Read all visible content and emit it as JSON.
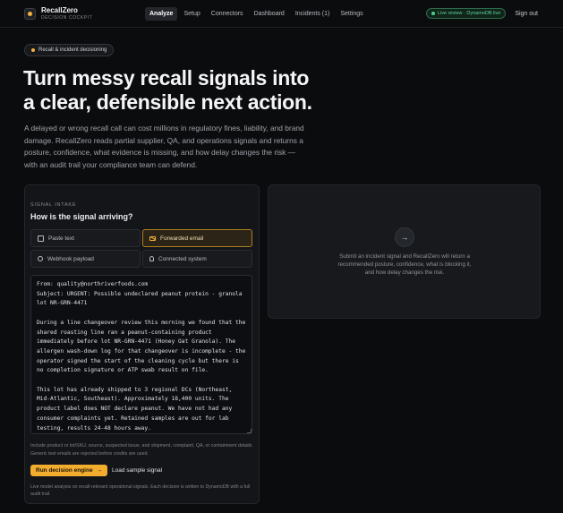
{
  "brand": {
    "name": "RecallZero",
    "subtitle": "DECISION COCKPIT"
  },
  "nav": {
    "links": [
      {
        "label": "Analyze",
        "active": true
      },
      {
        "label": "Setup",
        "active": false
      },
      {
        "label": "Connectors",
        "active": false
      },
      {
        "label": "Dashboard",
        "active": false
      },
      {
        "label": "Incidents (1)",
        "active": false
      },
      {
        "label": "Settings",
        "active": false
      }
    ],
    "live_status": "Live review · DynamoDB live",
    "sign_out": "Sign out"
  },
  "hero": {
    "badge": "Recall & incident decisioning",
    "title": "Turn messy recall signals into a clear, defensible next action.",
    "body": "A delayed or wrong recall call can cost millions in regulatory fines, liability, and brand damage. RecallZero reads partial supplier, QA, and operations signals and returns a posture, confidence, what evidence is missing, and how delay changes the risk — with an audit trail your compliance team can defend."
  },
  "intake": {
    "eyebrow": "SIGNAL INTAKE",
    "title": "How is the signal arriving?",
    "options": [
      {
        "label": "Paste text",
        "icon": "document-icon",
        "selected": false
      },
      {
        "label": "Forwarded email",
        "icon": "mail-icon",
        "selected": true
      },
      {
        "label": "Webhook payload",
        "icon": "webhook-icon",
        "selected": false
      },
      {
        "label": "Connected system",
        "icon": "plug-icon",
        "selected": false
      }
    ],
    "signal_text": "From: quality@northriverfoods.com\nSubject: URGENT: Possible undeclared peanut protein - granola lot NR-GRN-4471\n\nDuring a line changeover review this morning we found that the shared roasting line ran a peanut-containing product immediately before lot NR-GRN-4471 (Honey Oat Granola). The allergen wash-down log for that changeover is incomplete - the operator signed the start of the cleaning cycle but there is no completion signature or ATP swab result on file.\n\nThis lot has already shipped to 3 regional DCs (Northeast, Mid-Atlantic, Southeast). Approximately 18,400 units. The product label does NOT declare peanut. We have not had any consumer complaints yet. Retained samples are out for lab testing, results 24-48 hours away.",
    "helper": "Include product or lot/SKU, source, suspected issue, and shipment, complaint, QA, or containment details. Generic test emails are rejected before credits are used.",
    "run_label": "Run decision engine",
    "run_icon": "arrow-right-icon",
    "load_label": "Load sample signal",
    "footnote": "Live model analysis on recall-relevant operational signals. Each decision is written to DynamoDB with a full audit trail."
  },
  "result": {
    "icon": "arrow-right-icon",
    "empty_text": "Submit an incident signal and RecallZero will return a recommended posture, confidence, what is blocking it, and how delay changes the risk."
  },
  "colors": {
    "accent": "#f2ad2e",
    "live": "#45d08a",
    "background": "#0b0c0e"
  }
}
